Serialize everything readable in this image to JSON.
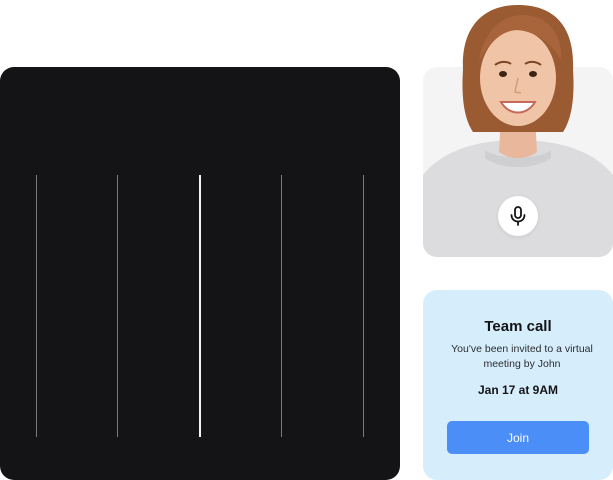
{
  "colors": {
    "dark_panel": "#141416",
    "card_background": "#d6eefc",
    "join_button": "#4b8ef8",
    "video_background": "#f4f4f5"
  },
  "video": {
    "mic_icon": "microphone-icon"
  },
  "invitation": {
    "title": "Team call",
    "message": "You've been invited to a virtual meeting by John",
    "time": "Jan 17 at 9AM",
    "join_label": "Join"
  }
}
